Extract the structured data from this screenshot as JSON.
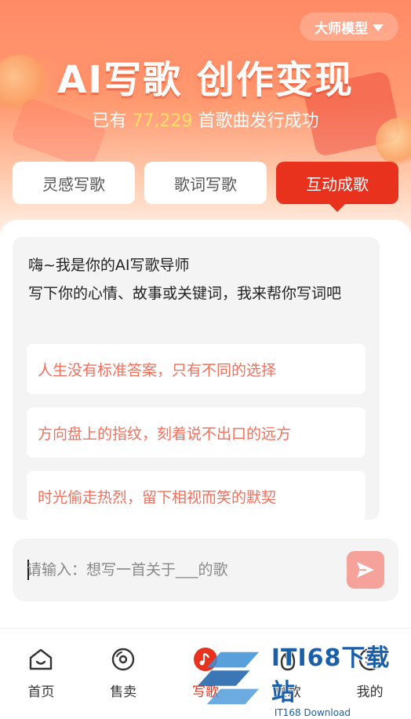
{
  "header": {
    "model_selector": "大师模型",
    "title": "AI写歌 创作变现",
    "subtitle_prefix": "已有",
    "subtitle_count": "77,229",
    "subtitle_suffix": "首歌曲发行成功"
  },
  "tabs": [
    {
      "label": "灵感写歌",
      "active": false
    },
    {
      "label": "歌词写歌",
      "active": false
    },
    {
      "label": "互动成歌",
      "active": true
    }
  ],
  "chat": {
    "greeting_line1": "嗨~我是你的AI写歌导师",
    "greeting_line2": "写下你的心情、故事或关键词，我来帮你写词吧",
    "suggestions": [
      "人生没有标准答案，只有不同的选择",
      "方向盘上的指纹，刻着说不出口的远方",
      "时光偷走热烈，留下相视而笑的默契"
    ]
  },
  "input": {
    "placeholder": "请输入：想写一首关于___的歌"
  },
  "nav": [
    {
      "label": "首页",
      "icon": "home-icon"
    },
    {
      "label": "售卖",
      "icon": "disc-icon"
    },
    {
      "label": "写歌",
      "icon": "music-note-icon",
      "active": true
    },
    {
      "label": "爆款",
      "icon": "fire-icon"
    },
    {
      "label": "我的",
      "icon": "smile-icon"
    }
  ],
  "watermark": {
    "main": "ITI68下载站",
    "sub": "IT168 Download"
  },
  "colors": {
    "accent": "#e8321e",
    "suggestion_text": "#f2705e",
    "count_highlight": "#ffe066",
    "send_button": "#f5a29a"
  }
}
